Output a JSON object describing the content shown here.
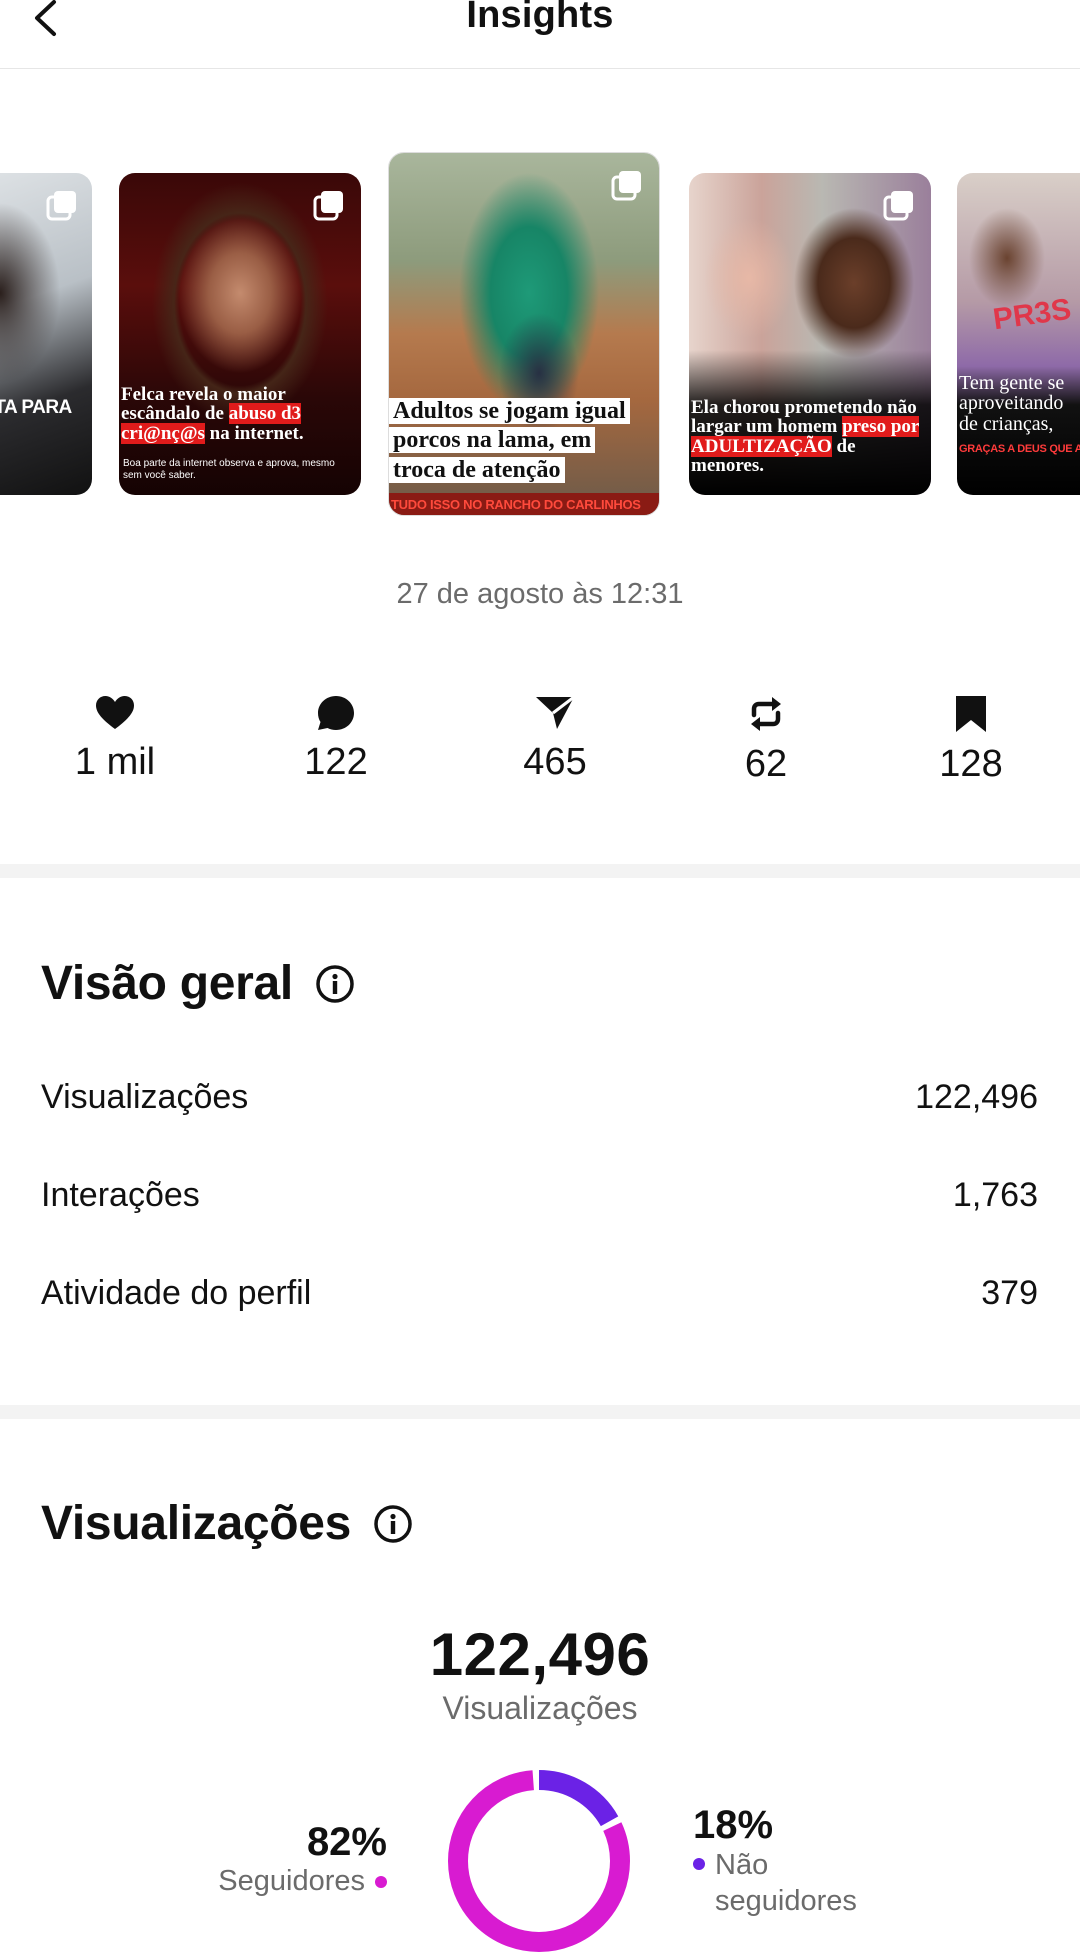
{
  "header": {
    "title": "Insights"
  },
  "carousel": {
    "cards": [
      {
        "caption": "PETA PARA SE."
      },
      {
        "caption_pre": "Felca revela o maior escândalo de ",
        "caption_hl1": "abuso d3",
        "caption_hl2": "cri@nç@s",
        "caption_post": " na internet.",
        "sub": "Boa parte da internet observa e aprova, mesmo sem você saber."
      },
      {
        "line1": "Adultos se jogam igual",
        "line2": "porcos na lama, em",
        "line3": "troca de atenção",
        "strip": "TUDO ISSO NO RANCHO DO CARLINHOS MAIA"
      },
      {
        "caption_pre": "Ela chorou prometendo não largar um homem ",
        "caption_hl": "preso por ADULTIZAÇÃO",
        "caption_post": " de menores."
      },
      {
        "caption": "Tem gente se aproveitando de crianças,",
        "strip": "GRAÇAS A DEUS QUE ALGO B",
        "shirt": "PR3S"
      }
    ]
  },
  "date": "27 de agosto às 12:31",
  "stats": [
    {
      "icon": "heart-icon",
      "value": "1 mil"
    },
    {
      "icon": "comment-icon",
      "value": "122"
    },
    {
      "icon": "share-icon",
      "value": "465"
    },
    {
      "icon": "repost-icon",
      "value": "62"
    },
    {
      "icon": "bookmark-icon",
      "value": "128"
    }
  ],
  "overview": {
    "title": "Visão geral",
    "rows": [
      {
        "label": "Visualizações",
        "value": "122,496"
      },
      {
        "label": "Interações",
        "value": "1,763"
      },
      {
        "label": "Atividade do perfil",
        "value": "379"
      }
    ]
  },
  "views": {
    "title": "Visualizações",
    "total": "122,496",
    "total_label": "Visualizações",
    "followers_pct": "82%",
    "followers_label": "Seguidores",
    "nonfollowers_pct": "18%",
    "nonfollowers_label_1": "Não",
    "nonfollowers_label_2": "seguidores",
    "followers_share": 0.82,
    "nonfollowers_share": 0.18,
    "colors": {
      "followers": "#d81bd1",
      "nonfollowers": "#6b22e6"
    }
  }
}
